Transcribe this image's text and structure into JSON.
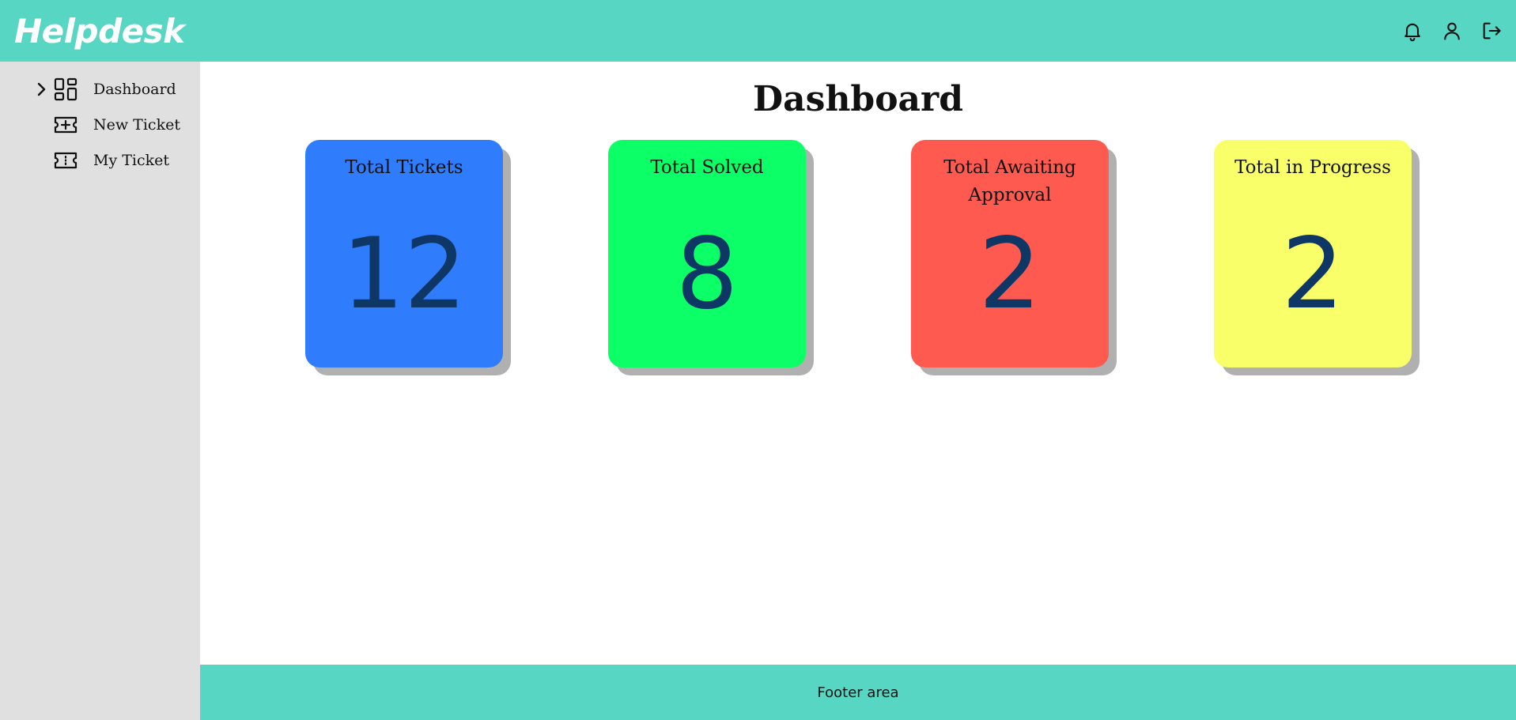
{
  "header": {
    "brand": "Helpdesk",
    "icons": [
      "bell-icon",
      "user-icon",
      "logout-icon"
    ],
    "color": "#56d6c3"
  },
  "sidebar": {
    "items": [
      {
        "label": "Dashboard",
        "icon": "dashboard-grid-icon",
        "active": true
      },
      {
        "label": "New Ticket",
        "icon": "ticket-plus-icon",
        "active": false
      },
      {
        "label": "My Ticket",
        "icon": "ticket-icon",
        "active": false
      }
    ]
  },
  "main": {
    "title": "Dashboard",
    "cards": [
      {
        "title": "Total Tickets",
        "value": "12",
        "color": "#2f7dfd"
      },
      {
        "title": "Total Solved",
        "value": "8",
        "color": "#0cff66"
      },
      {
        "title": "Total Awaiting Approval",
        "value": "2",
        "color": "#ff5a4f"
      },
      {
        "title": "Total in Progress",
        "value": "2",
        "color": "#f9ff69"
      }
    ]
  },
  "footer": {
    "text": "Footer area"
  }
}
